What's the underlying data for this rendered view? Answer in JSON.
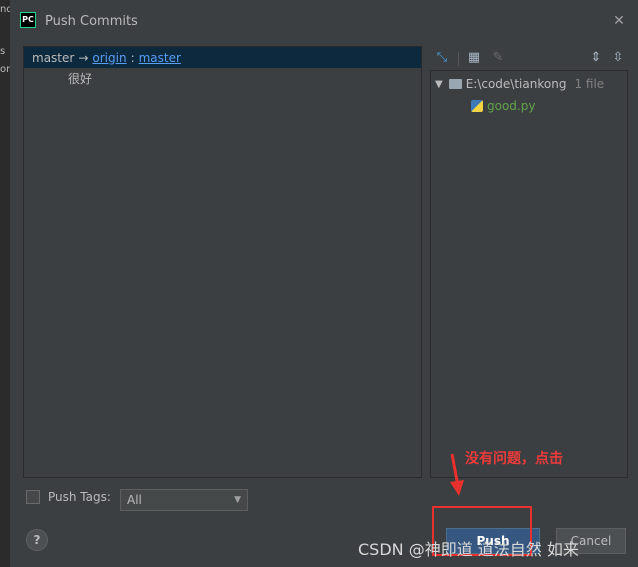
{
  "background_fragments": [
    "nd",
    "s",
    "on"
  ],
  "dialog": {
    "title": "Push Commits",
    "logo_text": "PC",
    "close_glyph": "✕"
  },
  "commits": {
    "branch_local": "master",
    "arrow": "→",
    "remote": "origin",
    "separator": ":",
    "branch_remote": "master",
    "message": "很好"
  },
  "toolbar": {
    "icons": [
      "expand-changes-icon",
      "group-by-icon",
      "edit-icon",
      "expand-all-icon",
      "collapse-all-icon"
    ]
  },
  "files": {
    "folder_path": "E:\\code\\tiankong",
    "file_count": "1 file",
    "file_name": "good.py"
  },
  "tags": {
    "label": "Push Tags:",
    "selected": "All"
  },
  "buttons": {
    "help": "?",
    "push": "Push",
    "cancel": "Cancel"
  },
  "annotation": {
    "text": "没有问题，点击",
    "color": "#e8302c"
  },
  "watermark": "CSDN @神即道 道法自然 如来"
}
